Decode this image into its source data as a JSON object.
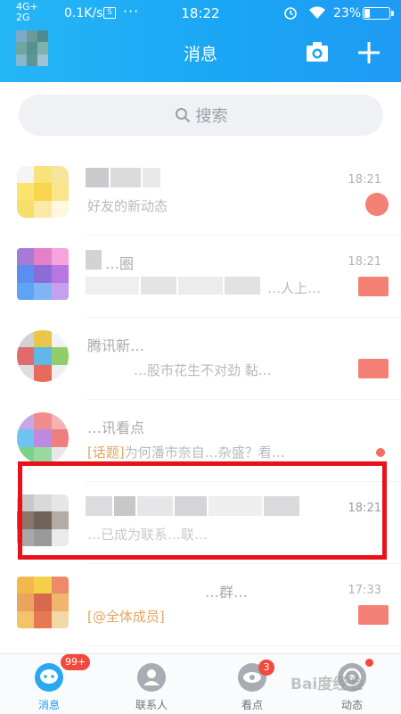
{
  "status_bar": {
    "network_top": "4G+",
    "network_bottom": "2G",
    "speed": "0.1K/s",
    "s_icon_label": "S",
    "more": "···",
    "time": "18:22",
    "battery": "23%",
    "battery_level": 0.23
  },
  "header": {
    "title": "消息",
    "camera_icon": "camera-icon",
    "add_icon": "plus-icon"
  },
  "search": {
    "placeholder": "搜索",
    "icon": "search-icon"
  },
  "conversations": [
    {
      "name": "",
      "message": "好友的新动态",
      "message_tag": "",
      "time": "18:21",
      "indicator": "badge"
    },
    {
      "name": "…圈",
      "message": "…人上…",
      "message_tag": "",
      "time": "18:21",
      "indicator": "badge"
    },
    {
      "name": "腾讯新…",
      "message": "…股市花生不对劲 黏…",
      "message_tag": "",
      "time": "",
      "indicator": "badge"
    },
    {
      "name": "…讯看点",
      "message": "为何潘市奈自…杂盛？看…",
      "message_tag": "[话题]",
      "time": "",
      "indicator": "dot"
    },
    {
      "name": "",
      "message": "…已成为联系…联…",
      "message_tag": "",
      "time": "18:21",
      "indicator": "none"
    },
    {
      "name": "…群…",
      "message": "",
      "message_tag": "[@全体成员]",
      "time": "17:33",
      "indicator": "badge"
    }
  ],
  "tabs": [
    {
      "label": "消息",
      "icon": "message-tab-icon",
      "badge": "99+",
      "active": true
    },
    {
      "label": "联系人",
      "icon": "contacts-tab-icon",
      "badge": "",
      "active": false
    },
    {
      "label": "看点",
      "icon": "kandian-tab-icon",
      "badge": "3",
      "active": false
    },
    {
      "label": "动态",
      "icon": "feeds-tab-icon",
      "badge": "",
      "active": false
    }
  ],
  "watermark": "Bai度经验",
  "colors": {
    "header_blue": "#1ba6f5",
    "highlight_red": "#e8101a",
    "badge_red": "#f2493b",
    "active_tab": "#1e9bf3"
  }
}
